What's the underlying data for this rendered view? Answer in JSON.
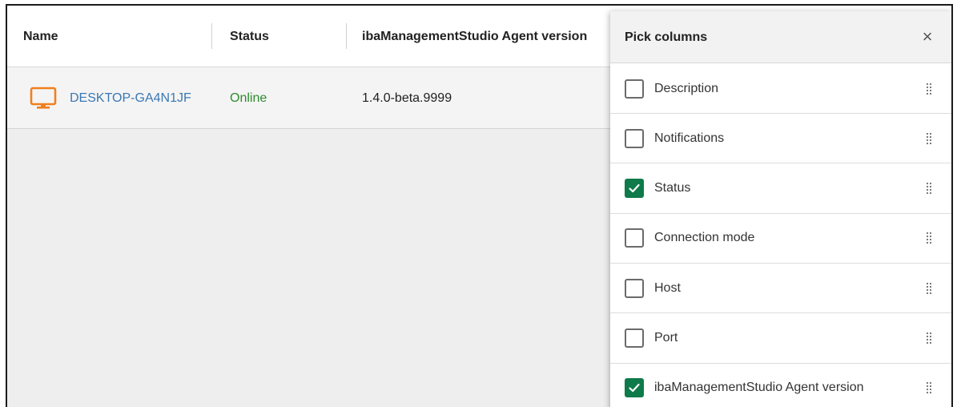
{
  "grid": {
    "columns": [
      {
        "label": "Name"
      },
      {
        "label": "Status"
      },
      {
        "label": "ibaManagementStudio Agent version"
      }
    ],
    "rows": [
      {
        "name": "DESKTOP-GA4N1JF",
        "status": "Online",
        "version": "1.4.0-beta.9999",
        "icon": "monitor-icon"
      }
    ]
  },
  "panel": {
    "title": "Pick columns",
    "close_icon": "×",
    "items": [
      {
        "label": "Description",
        "checked": false
      },
      {
        "label": "Notifications",
        "checked": false
      },
      {
        "label": "Status",
        "checked": true
      },
      {
        "label": "Connection mode",
        "checked": false
      },
      {
        "label": "Host",
        "checked": false
      },
      {
        "label": "Port",
        "checked": false
      },
      {
        "label": "ibaManagementStudio Agent version",
        "checked": true
      }
    ]
  },
  "colors": {
    "accent_check": "#0f7a4a",
    "link": "#3a78b5",
    "online": "#2e8b2e",
    "monitor_icon": "#f07f1e"
  }
}
